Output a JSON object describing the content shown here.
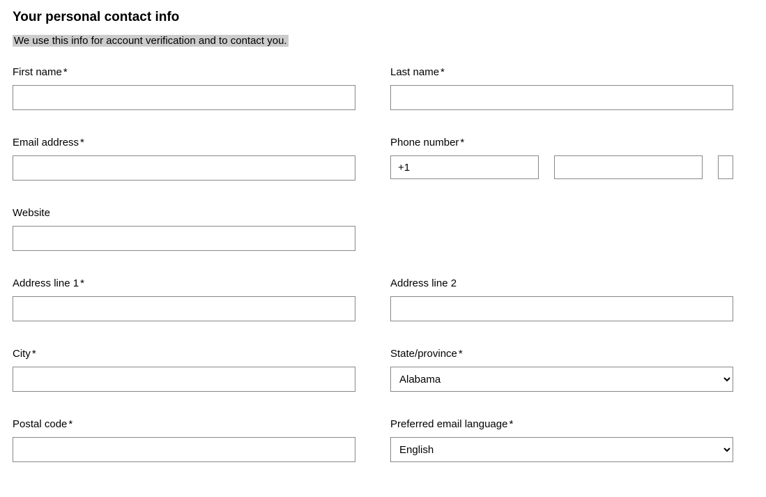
{
  "heading": "Your personal contact info",
  "subtitle": "We use this info for account verification and to contact you.",
  "fields": {
    "first_name": {
      "label": "First name",
      "required": "*",
      "value": ""
    },
    "last_name": {
      "label": "Last name",
      "required": "*",
      "value": ""
    },
    "email": {
      "label": "Email address",
      "required": "*",
      "value": ""
    },
    "phone": {
      "label": "Phone number",
      "required": "*",
      "country_code": "+1",
      "area": "",
      "number": ""
    },
    "website": {
      "label": "Website",
      "required": "",
      "value": ""
    },
    "address1": {
      "label": "Address line 1",
      "required": "*",
      "value": ""
    },
    "address2": {
      "label": "Address line 2",
      "required": "",
      "value": ""
    },
    "city": {
      "label": "City",
      "required": "*",
      "value": ""
    },
    "state": {
      "label": "State/province",
      "required": "*",
      "selected": "Alabama",
      "options": [
        "Alabama"
      ]
    },
    "postal": {
      "label": "Postal code",
      "required": "*",
      "value": ""
    },
    "lang": {
      "label": "Preferred email language",
      "required": "*",
      "selected": "English",
      "options": [
        "English"
      ]
    }
  }
}
